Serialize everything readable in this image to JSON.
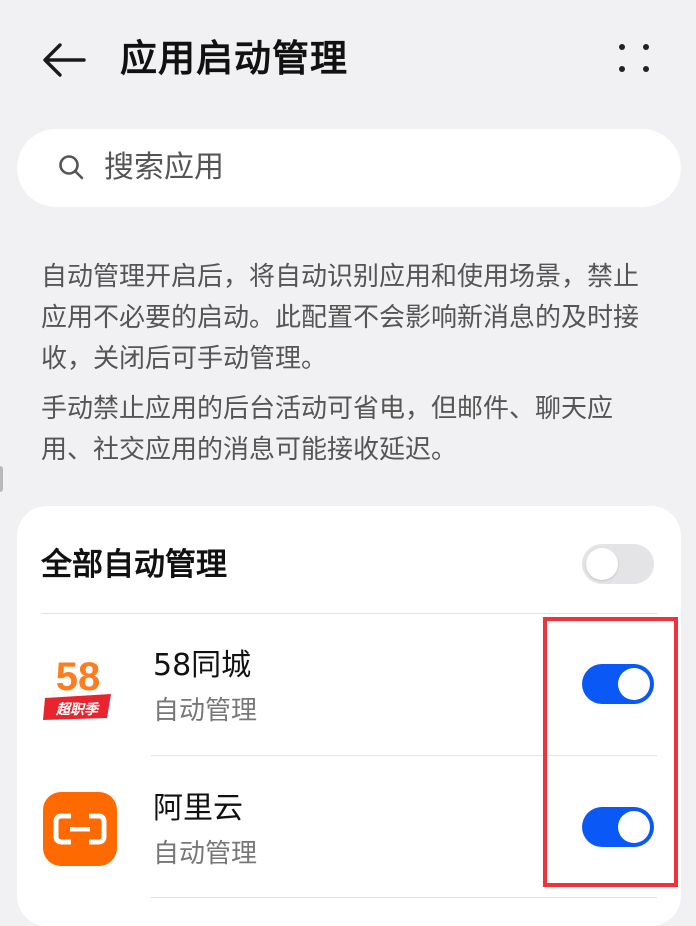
{
  "header": {
    "title": "应用启动管理",
    "back_icon": "arrow-left-icon",
    "more_icon": "more-dots-icon"
  },
  "search": {
    "placeholder": "搜索应用",
    "icon": "search-icon"
  },
  "description": {
    "paragraph1": "自动管理开启后，将自动识别应用和使用场景，禁止应用不必要的启动。此配置不会影响新消息的及时接收，关闭后可手动管理。",
    "paragraph2": "手动禁止应用的后台活动可省电，但邮件、聊天应用、社交应用的消息可能接收延迟。"
  },
  "all_manage": {
    "label": "全部自动管理",
    "enabled": false
  },
  "apps": [
    {
      "name": "58同城",
      "status": "自动管理",
      "enabled": true,
      "icon": "58-tongcheng-logo-icon",
      "icon_number": "58",
      "icon_badge": "超职季"
    },
    {
      "name": "阿里云",
      "status": "自动管理",
      "enabled": true,
      "icon": "aliyun-logo-icon"
    }
  ],
  "colors": {
    "accent": "#0a59f7",
    "background": "#f1f1f3",
    "card": "#ffffff",
    "highlight": "#f0333b",
    "aliyun_orange": "#ff6a00"
  }
}
